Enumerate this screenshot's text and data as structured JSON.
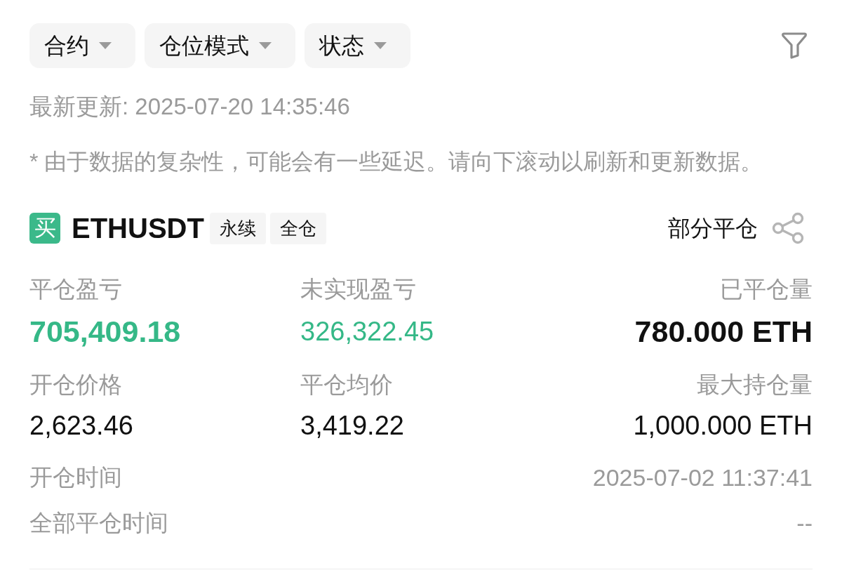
{
  "filters": [
    {
      "label": "合约"
    },
    {
      "label": "仓位模式"
    },
    {
      "label": "状态"
    }
  ],
  "last_updated": "最新更新: 2025-07-20 14:35:46",
  "notice": "* 由于数据的复杂性，可能会有一些延迟。请向下滚动以刷新和更新数据。",
  "position": {
    "side": "买",
    "symbol": "ETHUSDT",
    "tags": [
      "永续",
      "全仓"
    ],
    "action": "部分平仓",
    "stats": [
      {
        "label": "平仓盈亏",
        "value": "705,409.18",
        "color": "#35b887",
        "emphasis": true
      },
      {
        "label": "未实现盈亏",
        "value": "326,322.45",
        "color": "#35b887",
        "emphasis": false
      },
      {
        "label": "已平仓量",
        "value": "780.000 ETH",
        "color": "#111111",
        "emphasis": true
      },
      {
        "label": "开仓价格",
        "value": "2,623.46",
        "color": "#111111",
        "emphasis": false
      },
      {
        "label": "平仓均价",
        "value": "3,419.22",
        "color": "#111111",
        "emphasis": false
      },
      {
        "label": "最大持仓量",
        "value": "1,000.000 ETH",
        "color": "#111111",
        "emphasis": false
      }
    ],
    "details": [
      {
        "label": "开仓时间",
        "value": "2025-07-02 11:37:41"
      },
      {
        "label": "全部平仓时间",
        "value": "--"
      }
    ]
  }
}
